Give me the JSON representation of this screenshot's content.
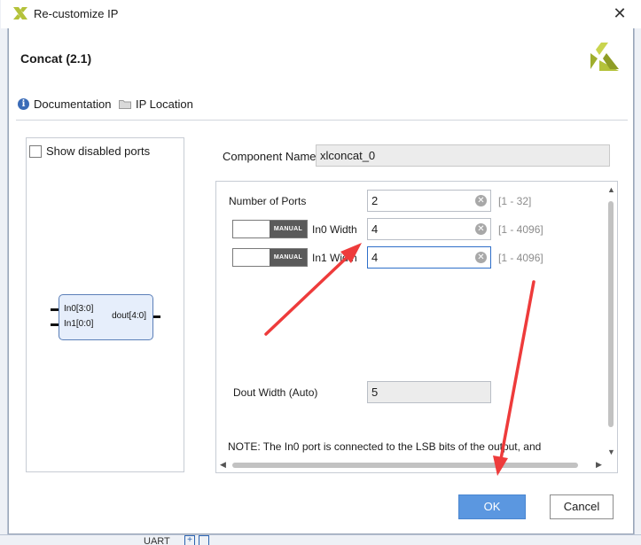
{
  "window": {
    "title": "Re-customize IP",
    "close_glyph": "✕"
  },
  "header": {
    "ip_name": "Concat (2.1)",
    "logo_icon": "xilinx-logo-icon"
  },
  "links": {
    "documentation": "Documentation",
    "ip_location": "IP Location"
  },
  "symbol": {
    "show_disabled_ports_label": "Show disabled ports",
    "show_disabled_ports_checked": false,
    "ports_in": [
      "In0[3:0]",
      "In1[0:0]"
    ],
    "port_out": "dout[4:0]"
  },
  "component": {
    "label": "Component Name",
    "value": "xlconcat_0"
  },
  "params": {
    "num_ports": {
      "label": "Number of Ports",
      "value": "2",
      "range": "[1 - 32]"
    },
    "in0_width": {
      "label": "In0 Width",
      "value": "4",
      "range": "[1 - 4096]",
      "mode": "MANUAL"
    },
    "in1_width": {
      "label": "In1 Width",
      "value": "4",
      "range": "[1 - 4096]",
      "mode": "MANUAL"
    },
    "dout_width": {
      "label": "Dout Width (Auto)",
      "value": "5"
    },
    "note": "NOTE: The In0 port is connected to the LSB bits of the output, and"
  },
  "buttons": {
    "ok": "OK",
    "cancel": "Cancel"
  },
  "background_app": {
    "bottom_text": "UART"
  },
  "colors": {
    "accent": "#5b97e0",
    "annotation": "#ee3b3b",
    "brand": "#b4c23a"
  }
}
